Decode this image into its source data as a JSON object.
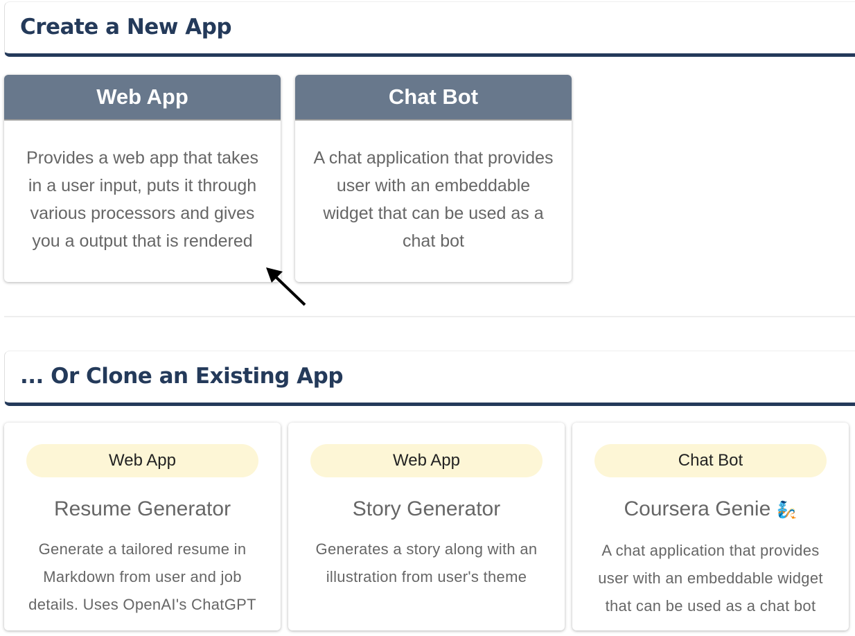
{
  "create_section": {
    "title": "Create a New App",
    "cards": [
      {
        "title": "Web App",
        "description": "Provides a web app that takes in a user input, puts it through various processors and gives you a output that is rendered"
      },
      {
        "title": "Chat Bot",
        "description": "A chat application that provides user with an embeddable widget that can be used as a chat bot"
      }
    ]
  },
  "clone_section": {
    "title": "... Or Clone an Existing App",
    "cards": [
      {
        "type": "Web App",
        "name": "Resume Generator",
        "description": "Generate a tailored resume in Markdown from user and job details. Uses OpenAI's ChatGPT"
      },
      {
        "type": "Web App",
        "name": "Story Generator",
        "description": "Generates a story along with an illustration from user's theme"
      },
      {
        "type": "Chat Bot",
        "name": "Coursera Genie",
        "icon": "genie-emoji",
        "description": "A chat application that provides user with an embeddable widget that can be used as a chat bot"
      }
    ]
  }
}
